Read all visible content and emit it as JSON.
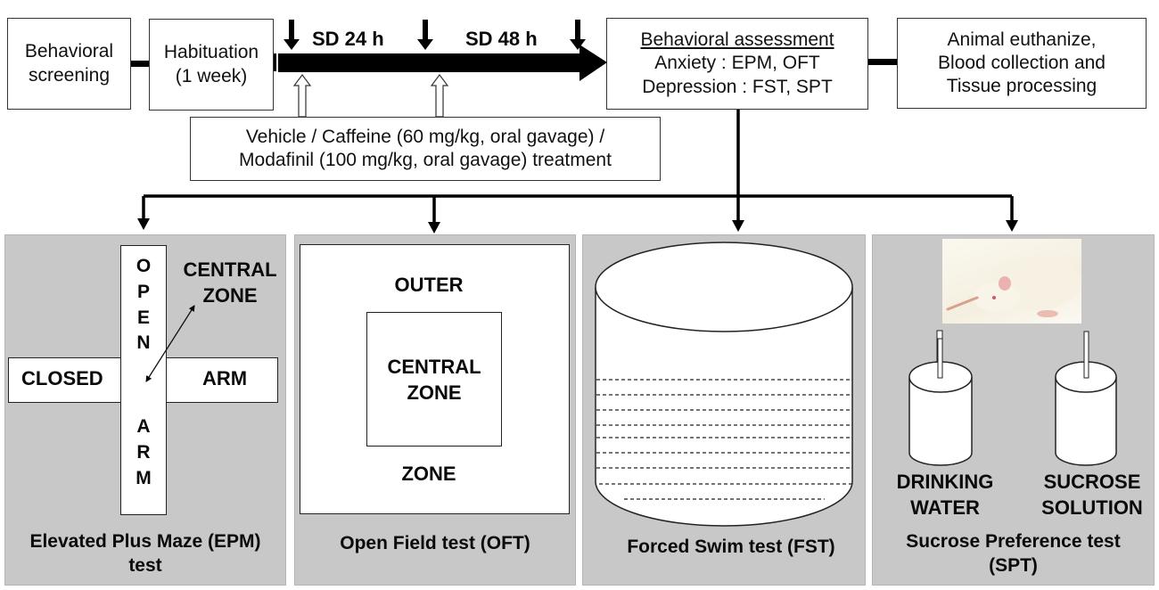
{
  "timeline": {
    "step1": [
      "Behavioral",
      "screening"
    ],
    "step2": [
      "Habituation",
      "(1 week)"
    ],
    "sd24": "SD 24 h",
    "sd48": "SD 48 h",
    "treatment": [
      "Vehicle / Caffeine (60 mg/kg, oral gavage) /",
      "Modafinil (100 mg/kg, oral gavage) treatment"
    ],
    "assessment": {
      "title": "Behavioral assessment",
      "anxiety": "Anxiety : EPM, OFT",
      "depression": "Depression : FST, SPT"
    },
    "final": [
      "Animal euthanize,",
      "Blood collection and",
      "Tissue processing"
    ]
  },
  "panels": {
    "epm": {
      "open_letters_top": [
        "O",
        "P",
        "E",
        "N"
      ],
      "open_letters_bottom": [
        "A",
        "R",
        "M"
      ],
      "closed": "CLOSED",
      "arm": "ARM",
      "central": [
        "CENTRAL",
        "ZONE"
      ],
      "caption": [
        "Elevated Plus Maze (EPM)",
        "test"
      ]
    },
    "oft": {
      "outer_top": "OUTER",
      "outer_bottom": "ZONE",
      "central": [
        "CENTRAL",
        "ZONE"
      ],
      "caption": "Open Field test (OFT)"
    },
    "fst": {
      "caption": "Forced Swim test (FST)"
    },
    "spt": {
      "bottle1": [
        "DRINKING",
        "WATER"
      ],
      "bottle2": [
        "SUCROSE",
        "SOLUTION"
      ],
      "caption": [
        "Sucrose Preference test",
        "(SPT)"
      ]
    }
  },
  "colors": {
    "panel_bg": "#c8c8c8",
    "arrow": "#000000"
  }
}
